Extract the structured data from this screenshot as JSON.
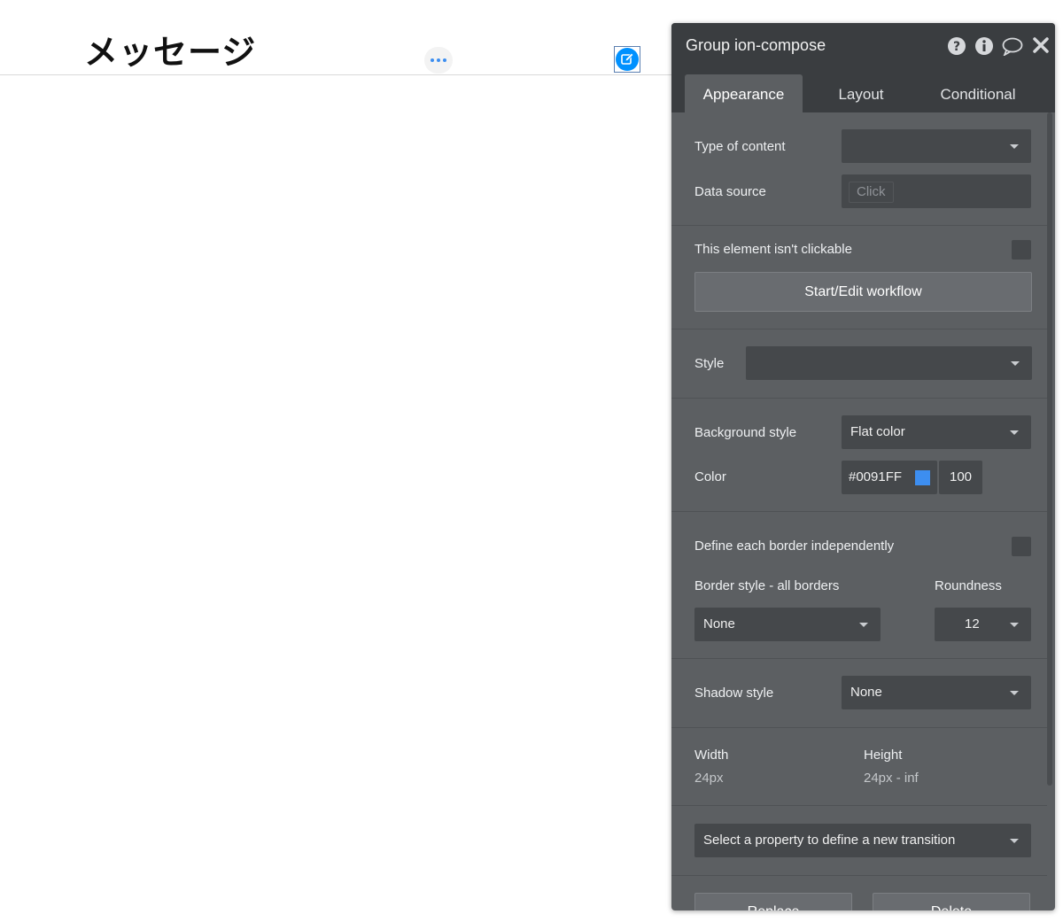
{
  "canvas": {
    "title": "メッセージ",
    "more_icon": "ellipsis-icon",
    "compose_icon": "compose-icon",
    "accent_color": "#0091FF"
  },
  "panel": {
    "title": "Group ion-compose",
    "header_icons": [
      "help-icon",
      "info-icon",
      "comment-icon",
      "close-icon"
    ],
    "tabs": [
      {
        "label": "Appearance",
        "active": true
      },
      {
        "label": "Layout",
        "active": false
      },
      {
        "label": "Conditional",
        "active": false
      }
    ],
    "type_of_content": {
      "label": "Type of content",
      "value": ""
    },
    "data_source": {
      "label": "Data source",
      "placeholder": "Click"
    },
    "clickable": {
      "label": "This element isn't clickable",
      "checked": false
    },
    "workflow_button": "Start/Edit workflow",
    "style": {
      "label": "Style",
      "value": ""
    },
    "background_style": {
      "label": "Background style",
      "value": "Flat color"
    },
    "color": {
      "label": "Color",
      "hex": "#0091FF",
      "opacity": "100"
    },
    "border_independent": {
      "label": "Define each border independently",
      "checked": false
    },
    "border_style": {
      "label": "Border style - all borders",
      "value": "None"
    },
    "roundness": {
      "label": "Roundness",
      "value": "12"
    },
    "shadow_style": {
      "label": "Shadow style",
      "value": "None"
    },
    "size": {
      "width_label": "Width",
      "width_value": "24px",
      "height_label": "Height",
      "height_value": "24px - inf"
    },
    "transition": {
      "placeholder": "Select a property to define a new transition"
    },
    "footer_buttons": {
      "replace": "Replace",
      "delete": "Delete"
    },
    "colors": {
      "panel_bg": "#5c5f62",
      "header_bg": "#3a3d40",
      "field_bg": "#45484b",
      "swatch": "#3d8ef0"
    }
  }
}
